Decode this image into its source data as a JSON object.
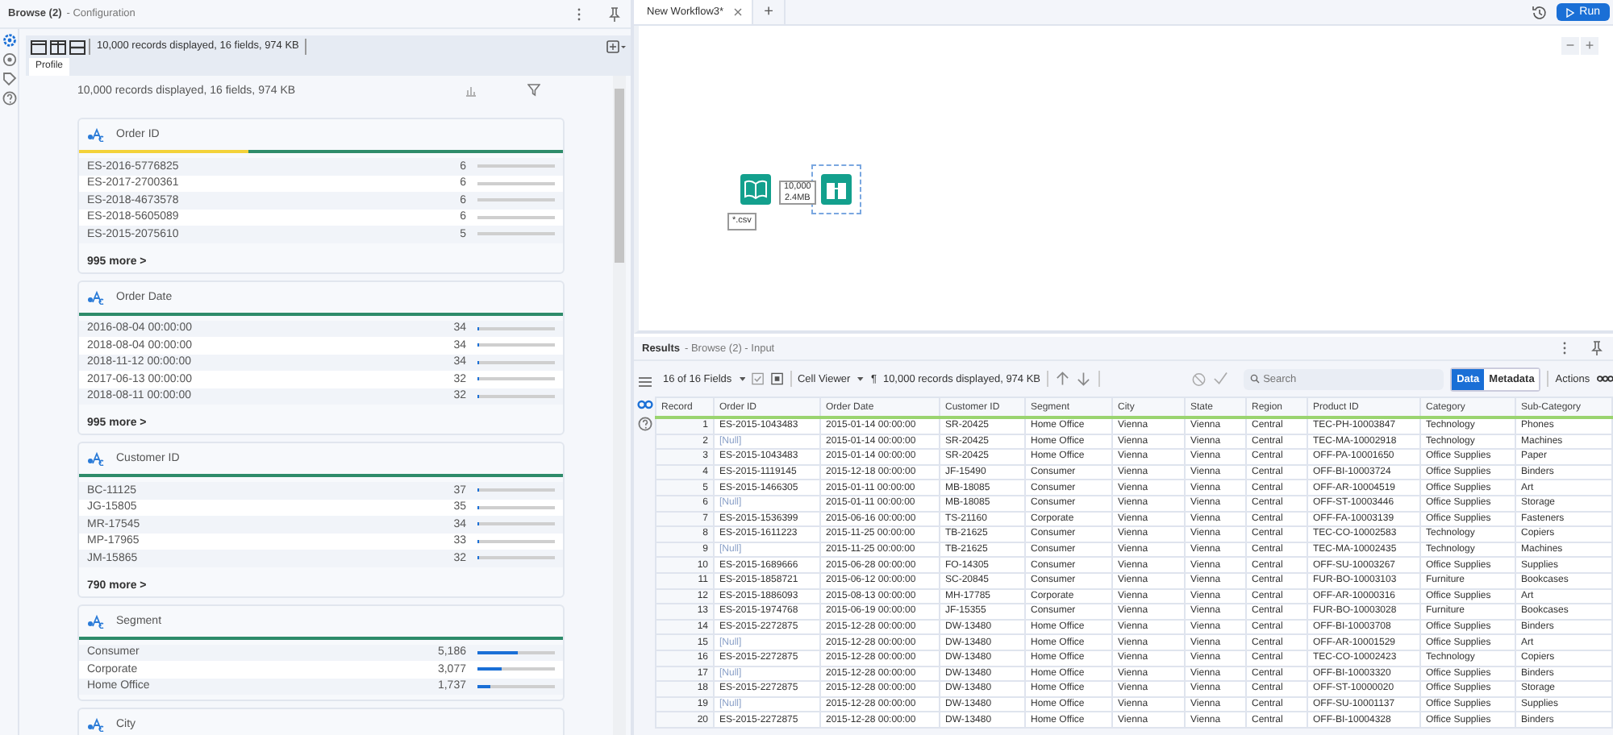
{
  "left_panel": {
    "title": "Browse (2)",
    "subtitle": "- Configuration",
    "side_icons": [
      {
        "kind": "gear",
        "selected": true
      },
      {
        "kind": "target",
        "selected": false
      },
      {
        "kind": "tag",
        "selected": false
      },
      {
        "kind": "help",
        "selected": false
      }
    ],
    "toolbar_summary": "10,000 records displayed, 16 fields, 974 KB",
    "tabs": [
      {
        "label": "Profile",
        "selected": true
      }
    ],
    "summary": "10,000 records displayed, 16 fields, 974 KB",
    "cards": [
      {
        "title": "Order ID",
        "quality": {
          "level": 0.35
        },
        "more": "995 more >",
        "rows": [
          {
            "value": "ES-2016-5776825",
            "count": "6",
            "level": 0.0006
          },
          {
            "value": "ES-2017-2700361",
            "count": "6",
            "level": 0.0006
          },
          {
            "value": "ES-2018-4673578",
            "count": "6",
            "level": 0.0006
          },
          {
            "value": "ES-2018-5605089",
            "count": "6",
            "level": 0.0006
          },
          {
            "value": "ES-2015-2075610",
            "count": "5",
            "level": 0.0005
          }
        ]
      },
      {
        "title": "Order Date",
        "more": "995 more >",
        "rows": [
          {
            "value": "2016-08-04 00:00:00",
            "count": "34",
            "level": 0.0034
          },
          {
            "value": "2018-08-04 00:00:00",
            "count": "34",
            "level": 0.0034
          },
          {
            "value": "2018-11-12 00:00:00",
            "count": "34",
            "level": 0.0034
          },
          {
            "value": "2017-06-13 00:00:00",
            "count": "32",
            "level": 0.0032
          },
          {
            "value": "2018-08-11 00:00:00",
            "count": "32",
            "level": 0.0032
          }
        ]
      },
      {
        "title": "Customer ID",
        "more": "790 more >",
        "rows": [
          {
            "value": "BC-11125",
            "count": "37",
            "level": 0.0037
          },
          {
            "value": "JG-15805",
            "count": "35",
            "level": 0.0035
          },
          {
            "value": "MR-17545",
            "count": "34",
            "level": 0.0034
          },
          {
            "value": "MP-17965",
            "count": "33",
            "level": 0.0033
          },
          {
            "value": "JM-15865",
            "count": "32",
            "level": 0.0032
          }
        ]
      },
      {
        "title": "Segment",
        "rows": [
          {
            "value": "Consumer",
            "count": "5,186",
            "level": 0.5186
          },
          {
            "value": "Corporate",
            "count": "3,077",
            "level": 0.3077
          },
          {
            "value": "Home Office",
            "count": "1,737",
            "level": 0.1737
          }
        ]
      },
      {
        "title": "City"
      }
    ]
  },
  "workflow": {
    "tabs": [
      {
        "label": "New Workflow3*",
        "selected": true
      }
    ],
    "add": "+",
    "run": "Run",
    "zoom_out": "−",
    "zoom_in": "+",
    "nodes": [
      {
        "kind": "input",
        "label": "*.csv",
        "selected": false
      },
      {
        "kind": "browse",
        "selected": true
      }
    ],
    "connection": {
      "records": "10,000",
      "size": "2.4MB"
    }
  },
  "results": {
    "title": "Results",
    "subtitle": "- Browse (2) - Input",
    "side_icons": [
      {
        "kind": "list",
        "selected": false
      },
      {
        "kind": "binoculars",
        "selected": true
      },
      {
        "kind": "help",
        "selected": false
      }
    ],
    "fields": "16 of 16 Fields",
    "viewer": "Cell Viewer",
    "pilcrow": "¶",
    "summary": "10,000 records displayed, 974 KB",
    "search": {
      "placeholder": "Search"
    },
    "view_toggle": [
      {
        "label": "Data",
        "selected": true
      },
      {
        "label": "Metadata",
        "selected": false
      }
    ],
    "actions": "Actions",
    "columns": [
      "Record",
      "Order ID",
      "Order Date",
      "Customer ID",
      "Segment",
      "City",
      "State",
      "Region",
      "Product ID",
      "Category",
      "Sub-Category"
    ],
    "rows": [
      {
        "null_order_id": false,
        "cells": [
          "1",
          "ES-2015-1043483",
          "2015-01-14 00:00:00",
          "SR-20425",
          "Home Office",
          "Vienna",
          "Vienna",
          "Central",
          "TEC-PH-10003847",
          "Technology",
          "Phones"
        ]
      },
      {
        "null_order_id": true,
        "cells": [
          "2",
          "[Null]",
          "2015-01-14 00:00:00",
          "SR-20425",
          "Home Office",
          "Vienna",
          "Vienna",
          "Central",
          "TEC-MA-10002918",
          "Technology",
          "Machines"
        ]
      },
      {
        "null_order_id": false,
        "cells": [
          "3",
          "ES-2015-1043483",
          "2015-01-14 00:00:00",
          "SR-20425",
          "Home Office",
          "Vienna",
          "Vienna",
          "Central",
          "OFF-PA-10001650",
          "Office Supplies",
          "Paper"
        ]
      },
      {
        "null_order_id": false,
        "cells": [
          "4",
          "ES-2015-1119145",
          "2015-12-18 00:00:00",
          "JF-15490",
          "Consumer",
          "Vienna",
          "Vienna",
          "Central",
          "OFF-BI-10003724",
          "Office Supplies",
          "Binders"
        ]
      },
      {
        "null_order_id": false,
        "cells": [
          "5",
          "ES-2015-1466305",
          "2015-01-11 00:00:00",
          "MB-18085",
          "Consumer",
          "Vienna",
          "Vienna",
          "Central",
          "OFF-AR-10004519",
          "Office Supplies",
          "Art"
        ]
      },
      {
        "null_order_id": true,
        "cells": [
          "6",
          "[Null]",
          "2015-01-11 00:00:00",
          "MB-18085",
          "Consumer",
          "Vienna",
          "Vienna",
          "Central",
          "OFF-ST-10003446",
          "Office Supplies",
          "Storage"
        ]
      },
      {
        "null_order_id": false,
        "cells": [
          "7",
          "ES-2015-1536399",
          "2015-06-16 00:00:00",
          "TS-21160",
          "Corporate",
          "Vienna",
          "Vienna",
          "Central",
          "OFF-FA-10003139",
          "Office Supplies",
          "Fasteners"
        ]
      },
      {
        "null_order_id": false,
        "cells": [
          "8",
          "ES-2015-1611223",
          "2015-11-25 00:00:00",
          "TB-21625",
          "Consumer",
          "Vienna",
          "Vienna",
          "Central",
          "TEC-CO-10002583",
          "Technology",
          "Copiers"
        ]
      },
      {
        "null_order_id": true,
        "cells": [
          "9",
          "[Null]",
          "2015-11-25 00:00:00",
          "TB-21625",
          "Consumer",
          "Vienna",
          "Vienna",
          "Central",
          "TEC-MA-10002435",
          "Technology",
          "Machines"
        ]
      },
      {
        "null_order_id": false,
        "cells": [
          "10",
          "ES-2015-1689666",
          "2015-06-28 00:00:00",
          "FO-14305",
          "Consumer",
          "Vienna",
          "Vienna",
          "Central",
          "OFF-SU-10003267",
          "Office Supplies",
          "Supplies"
        ]
      },
      {
        "null_order_id": false,
        "cells": [
          "11",
          "ES-2015-1858721",
          "2015-06-12 00:00:00",
          "SC-20845",
          "Consumer",
          "Vienna",
          "Vienna",
          "Central",
          "FUR-BO-10003103",
          "Furniture",
          "Bookcases"
        ]
      },
      {
        "null_order_id": false,
        "cells": [
          "12",
          "ES-2015-1886093",
          "2015-08-13 00:00:00",
          "MH-17785",
          "Corporate",
          "Vienna",
          "Vienna",
          "Central",
          "OFF-AR-10000316",
          "Office Supplies",
          "Art"
        ]
      },
      {
        "null_order_id": false,
        "cells": [
          "13",
          "ES-2015-1974768",
          "2015-06-19 00:00:00",
          "JF-15355",
          "Consumer",
          "Vienna",
          "Vienna",
          "Central",
          "FUR-BO-10003028",
          "Furniture",
          "Bookcases"
        ]
      },
      {
        "null_order_id": false,
        "cells": [
          "14",
          "ES-2015-2272875",
          "2015-12-28 00:00:00",
          "DW-13480",
          "Home Office",
          "Vienna",
          "Vienna",
          "Central",
          "OFF-BI-10003708",
          "Office Supplies",
          "Binders"
        ]
      },
      {
        "null_order_id": true,
        "cells": [
          "15",
          "[Null]",
          "2015-12-28 00:00:00",
          "DW-13480",
          "Home Office",
          "Vienna",
          "Vienna",
          "Central",
          "OFF-AR-10001529",
          "Office Supplies",
          "Art"
        ]
      },
      {
        "null_order_id": false,
        "cells": [
          "16",
          "ES-2015-2272875",
          "2015-12-28 00:00:00",
          "DW-13480",
          "Home Office",
          "Vienna",
          "Vienna",
          "Central",
          "TEC-CO-10002423",
          "Technology",
          "Copiers"
        ]
      },
      {
        "null_order_id": true,
        "cells": [
          "17",
          "[Null]",
          "2015-12-28 00:00:00",
          "DW-13480",
          "Home Office",
          "Vienna",
          "Vienna",
          "Central",
          "OFF-BI-10003320",
          "Office Supplies",
          "Binders"
        ]
      },
      {
        "null_order_id": false,
        "cells": [
          "18",
          "ES-2015-2272875",
          "2015-12-28 00:00:00",
          "DW-13480",
          "Home Office",
          "Vienna",
          "Vienna",
          "Central",
          "OFF-ST-10000020",
          "Office Supplies",
          "Storage"
        ]
      },
      {
        "null_order_id": true,
        "cells": [
          "19",
          "[Null]",
          "2015-12-28 00:00:00",
          "DW-13480",
          "Home Office",
          "Vienna",
          "Vienna",
          "Central",
          "OFF-SU-10001137",
          "Office Supplies",
          "Supplies"
        ]
      },
      {
        "null_order_id": false,
        "cells": [
          "20",
          "ES-2015-2272875",
          "2015-12-28 00:00:00",
          "DW-13480",
          "Home Office",
          "Vienna",
          "Vienna",
          "Central",
          "OFF-BI-10004328",
          "Office Supplies",
          "Binders"
        ]
      }
    ]
  }
}
